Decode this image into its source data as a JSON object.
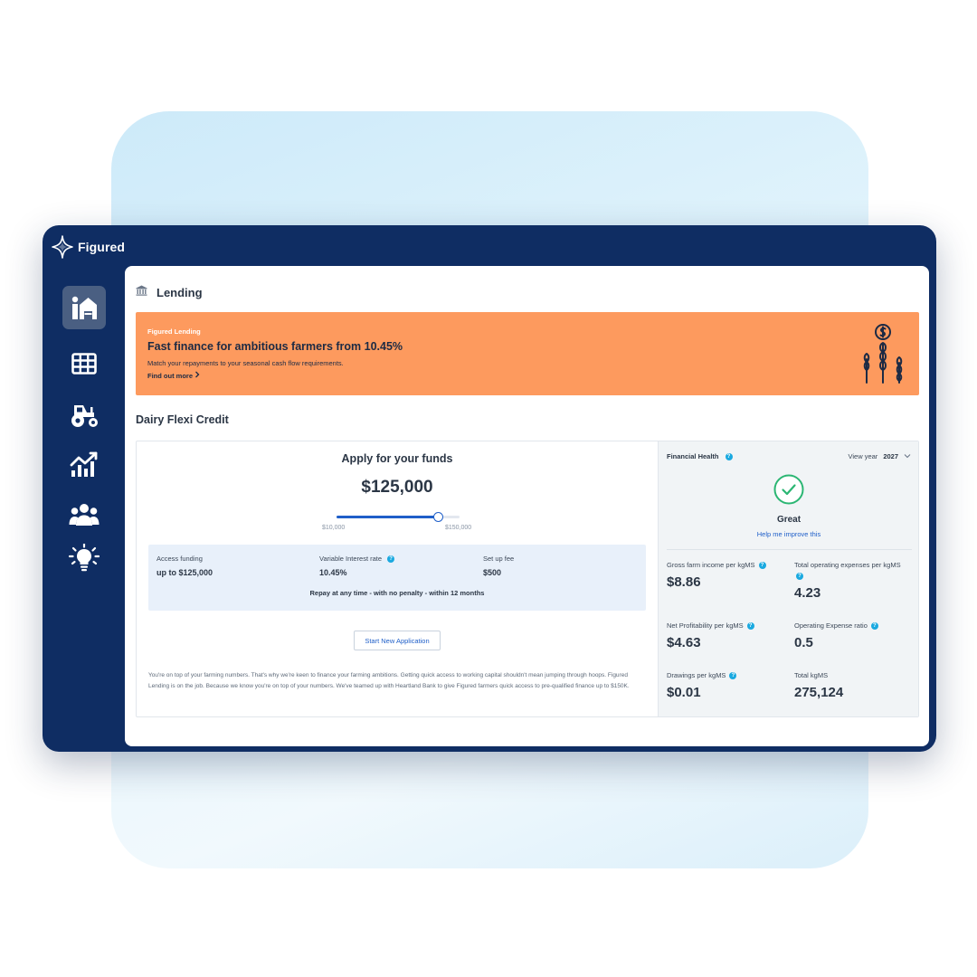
{
  "app": {
    "name": "Figured"
  },
  "page": {
    "title": "Lending"
  },
  "banner": {
    "eyebrow": "Figured Lending",
    "headline": "Fast finance for ambitious farmers from 10.45%",
    "subtext": "Match your repayments to your seasonal cash flow requirements.",
    "link": "Find out more"
  },
  "product": {
    "title": "Dairy Flexi Credit",
    "apply_title": "Apply for your funds",
    "amount": "$125,000",
    "slider": {
      "min_label": "$10,000",
      "max_label": "$150,000",
      "value_fraction": 0.82
    },
    "terms": [
      {
        "label": "Access funding",
        "value": "up to $125,000",
        "help": false
      },
      {
        "label": "Variable Interest rate",
        "value": "10.45%",
        "help": true
      },
      {
        "label": "Set up fee",
        "value": "$500",
        "help": false
      }
    ],
    "terms_note": "Repay at any time - with no penalty - within 12 months",
    "start_button": "Start New Application",
    "disclaimer": "You're on top of your farming numbers. That's why we're keen to finance your farming ambitions. Getting quick access to working capital shouldn't mean jumping through hoops. Figured Lending is on the job. Because we know you're on top of your numbers. We've teamed up with Heartland Bank to give Figured farmers quick access to pre-qualified finance up to $150K."
  },
  "health": {
    "title": "Financial Health",
    "view_year_label": "View year",
    "year": "2027",
    "status": "Great",
    "improve_link": "Help me improve this",
    "metrics": [
      {
        "label": "Gross farm income per kgMS",
        "value": "$8.86",
        "help": true
      },
      {
        "label": "Total operating expenses per kgMS",
        "value": "4.23",
        "help": true
      },
      {
        "label": "Net Profitability per kgMS",
        "value": "$4.63",
        "help": true
      },
      {
        "label": "Operating Expense ratio",
        "value": "0.5",
        "help": true
      },
      {
        "label": "Drawings per kgMS",
        "value": "$0.01",
        "help": true
      },
      {
        "label": "Total kgMS",
        "value": "275,124",
        "help": false
      }
    ]
  },
  "help_glyph": "?",
  "colors": {
    "sidebar": "#0f2d63",
    "banner": "#fd9a5e",
    "accent": "#1f5fc9",
    "success": "#2bb673",
    "help": "#1aa9e0"
  },
  "icons": {
    "nav": [
      "farm-barn-icon",
      "grid-table-icon",
      "tractor-icon",
      "chart-trend-icon",
      "team-people-icon",
      "lightbulb-icon"
    ],
    "page": "bank-icon",
    "banner": "wheat-coin-icon",
    "status": "check-circle-icon"
  }
}
